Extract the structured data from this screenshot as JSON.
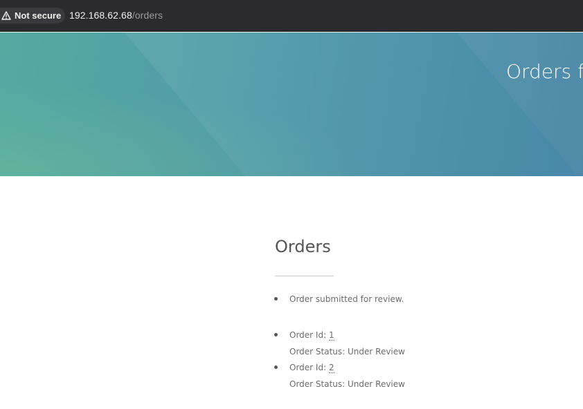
{
  "browser": {
    "security_label": "Not secure",
    "url_host": "192.168.62.68",
    "url_path": "/orders"
  },
  "hero": {
    "title": "Orders fo"
  },
  "main": {
    "title": "Orders",
    "message": "Order submitted for review.",
    "orders": [
      {
        "id_label": "Order Id: ",
        "id": "1",
        "status_label": "Order Status: ",
        "status": "Under Review"
      },
      {
        "id_label": "Order Id: ",
        "id": "2",
        "status_label": "Order Status: ",
        "status": "Under Review"
      }
    ]
  },
  "colors": {
    "addressbar": "#2b2b2f",
    "hero_start": "#56a9a1",
    "hero_end": "#4a88a9",
    "text": "#6b6b6b"
  },
  "icons": {
    "security": "warning-triangle-icon"
  }
}
